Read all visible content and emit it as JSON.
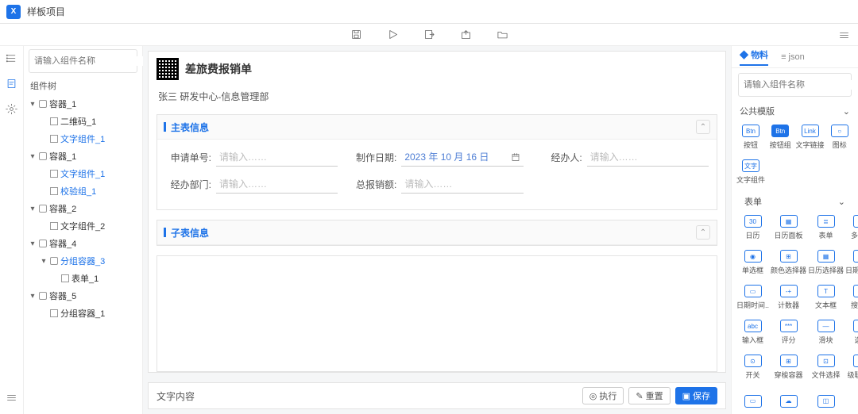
{
  "header": {
    "project_name": "样板项目"
  },
  "left": {
    "search_placeholder": "请输入组件名称",
    "panel_label": "组件树",
    "tree": [
      {
        "d": 0,
        "tw": "▾",
        "t": "c",
        "label": "容器_1"
      },
      {
        "d": 1,
        "tw": "",
        "t": "l",
        "label": "二维码_1",
        "blue": false
      },
      {
        "d": 1,
        "tw": "",
        "t": "l",
        "label": "文字组件_1",
        "blue": true
      },
      {
        "d": 0,
        "tw": "▾",
        "t": "c",
        "label": "容器_1"
      },
      {
        "d": 1,
        "tw": "",
        "t": "l",
        "label": "文字组件_1",
        "blue": true
      },
      {
        "d": 1,
        "tw": "",
        "t": "l",
        "label": "校验组_1",
        "blue": true
      },
      {
        "d": 0,
        "tw": "▾",
        "t": "c",
        "label": "容器_2"
      },
      {
        "d": 1,
        "tw": "",
        "t": "l",
        "label": "文字组件_2",
        "blue": false
      },
      {
        "d": 0,
        "tw": "▾",
        "t": "c",
        "label": "容器_4"
      },
      {
        "d": 1,
        "tw": "▾",
        "t": "c",
        "label": "分组容器_3",
        "blue": true
      },
      {
        "d": 2,
        "tw": "",
        "t": "l",
        "label": "表单_1",
        "blue": false
      },
      {
        "d": 0,
        "tw": "▾",
        "t": "c",
        "label": "容器_5"
      },
      {
        "d": 1,
        "tw": "",
        "t": "l",
        "label": "分组容器_1",
        "blue": false
      }
    ]
  },
  "form": {
    "title": "差旅费报销单",
    "subtitle": "张三 研发中心-信息管理部",
    "section1": {
      "title": "主表信息",
      "fields": [
        {
          "label": "申请单号:",
          "ph": "请输入……"
        },
        {
          "label": "制作日期:",
          "val": "2023 年 10 月 16 日",
          "date": true
        },
        {
          "label": "经办人:",
          "ph": "请输入……"
        },
        {
          "label": "经办部门:",
          "ph": "请输入……"
        },
        {
          "label": "总报销额:",
          "ph": "请输入……"
        }
      ]
    },
    "section2": {
      "title": "子表信息"
    },
    "footer": {
      "left_label": "文字内容",
      "actions": [
        "执行",
        "重置",
        "保存"
      ]
    }
  },
  "right": {
    "tabs": [
      "物料",
      "json"
    ],
    "search_placeholder": "请输入组件名称",
    "group1": {
      "title": "公共模版"
    },
    "basic": [
      {
        "ico": "Btn",
        "label": "按钮",
        "filled": false
      },
      {
        "ico": "Btn",
        "label": "按钮组",
        "filled": true
      },
      {
        "ico": "Link",
        "label": "文字链接",
        "filled": false
      },
      {
        "ico": "○",
        "label": "图标",
        "filled": false
      },
      {
        "ico": "文字",
        "label": "文字组件",
        "filled": false
      }
    ],
    "group2": {
      "title": "表单"
    },
    "widgets": [
      {
        "ico": "30",
        "label": "日历"
      },
      {
        "ico": "▦",
        "label": "日历面板"
      },
      {
        "ico": "≣",
        "label": "表单"
      },
      {
        "ico": "✓",
        "label": "多选框"
      },
      {
        "ico": "◉",
        "label": "单选框"
      },
      {
        "ico": "⊞",
        "label": "颜色选择器"
      },
      {
        "ico": "▦",
        "label": "日历选择器"
      },
      {
        "ico": "▦",
        "label": "日期时间.."
      },
      {
        "ico": "▭",
        "label": "日期时间.."
      },
      {
        "ico": "-+",
        "label": "计数器"
      },
      {
        "ico": "T",
        "label": "文本框"
      },
      {
        "ico": "⌕",
        "label": "搜索框"
      },
      {
        "ico": "abc",
        "label": "输入框"
      },
      {
        "ico": "***",
        "label": "评分"
      },
      {
        "ico": "—",
        "label": "滑块"
      },
      {
        "ico": "⊙",
        "label": "选择"
      },
      {
        "ico": "⊙",
        "label": "开关"
      },
      {
        "ico": "⊞",
        "label": "穿梭容器"
      },
      {
        "ico": "⊡",
        "label": "文件选择"
      },
      {
        "ico": "⊞",
        "label": "级联选择"
      },
      {
        "ico": "▭",
        "label": ""
      },
      {
        "ico": "☁",
        "label": ""
      },
      {
        "ico": "◫",
        "label": ""
      }
    ]
  }
}
